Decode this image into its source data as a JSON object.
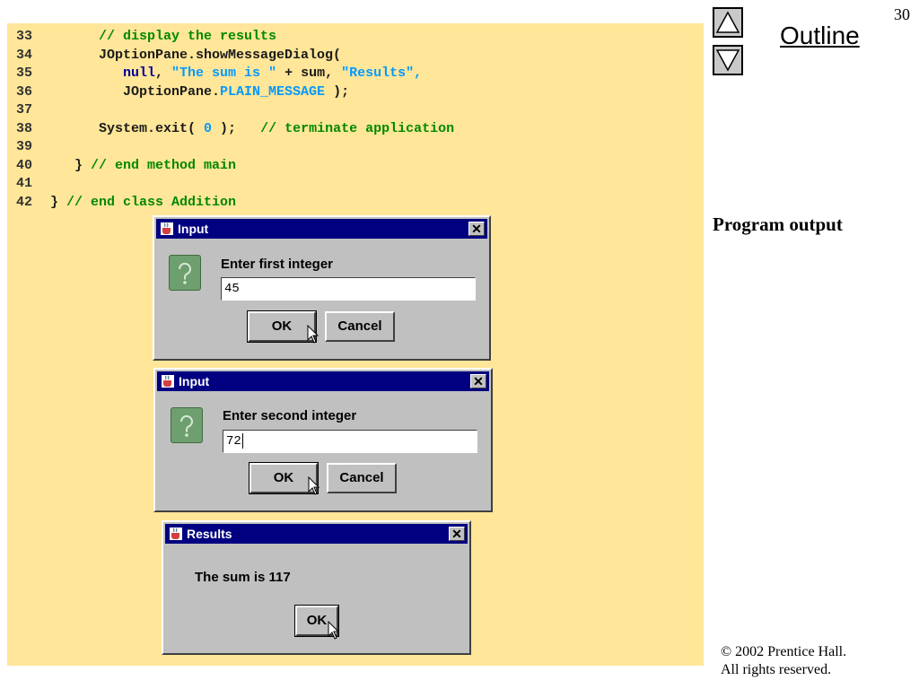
{
  "page_number": "30",
  "outline": {
    "label": "Outline",
    "up_icon": "triangle-up-icon",
    "down_icon": "triangle-down-icon"
  },
  "output_label": "Program output",
  "copyright": {
    "line1": "© 2002 Prentice Hall.",
    "line2": "All rights reserved."
  },
  "code": {
    "lines": [
      {
        "number": "33",
        "tokens": [
          {
            "t": "      ",
            "c": "t"
          },
          {
            "t": "// display the results",
            "c": "c"
          }
        ]
      },
      {
        "number": "34",
        "tokens": [
          {
            "t": "      JOptionPane.showMessageDialog(",
            "c": "t"
          }
        ]
      },
      {
        "number": "35",
        "tokens": [
          {
            "t": "         ",
            "c": "t"
          },
          {
            "t": "null",
            "c": "k"
          },
          {
            "t": ", ",
            "c": "t"
          },
          {
            "t": "\"The sum is \"",
            "c": "s"
          },
          {
            "t": " + sum, ",
            "c": "t"
          },
          {
            "t": "\"Results\",",
            "c": "s"
          }
        ]
      },
      {
        "number": "36",
        "tokens": [
          {
            "t": "         JOptionPane.",
            "c": "t"
          },
          {
            "t": "PLAIN_MESSAGE",
            "c": "s"
          },
          {
            "t": " );",
            "c": "t"
          }
        ]
      },
      {
        "number": "37",
        "tokens": []
      },
      {
        "number": "38",
        "tokens": [
          {
            "t": "      System.exit( ",
            "c": "t"
          },
          {
            "t": "0",
            "c": "s"
          },
          {
            "t": " );   ",
            "c": "t"
          },
          {
            "t": "// terminate application",
            "c": "c"
          }
        ]
      },
      {
        "number": "39",
        "tokens": []
      },
      {
        "number": "40",
        "tokens": [
          {
            "t": "   } ",
            "c": "t"
          },
          {
            "t": "// end method main",
            "c": "c"
          }
        ]
      },
      {
        "number": "41",
        "tokens": []
      },
      {
        "number": "42",
        "tokens": [
          {
            "t": "} ",
            "c": "t"
          },
          {
            "t": "// end class Addition",
            "c": "c"
          }
        ]
      }
    ]
  },
  "dialogs": {
    "input1": {
      "title": "Input",
      "close_glyph": "✕",
      "prompt": "Enter first integer",
      "value": "45",
      "ok_label": "OK",
      "cancel_label": "Cancel"
    },
    "input2": {
      "title": "Input",
      "close_glyph": "✕",
      "prompt": "Enter second integer",
      "value": "72",
      "ok_label": "OK",
      "cancel_label": "Cancel"
    },
    "results": {
      "title": "Results",
      "close_glyph": "✕",
      "message": "The sum is 117",
      "ok_label": "OK"
    }
  },
  "colors": {
    "code_background": "#ffe699",
    "comment": "#008800",
    "keyword": "#000099",
    "string": "#0099ff",
    "titlebar": "#000080",
    "dialog": "#c0c0c0"
  }
}
